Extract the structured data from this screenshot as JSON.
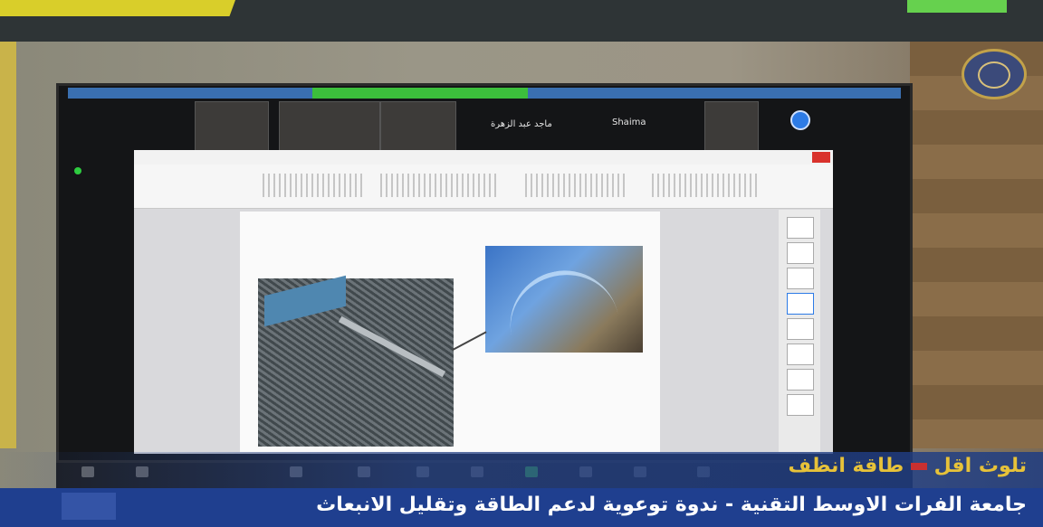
{
  "headline": {
    "part1": "تلوث اقل",
    "part2": "طاقة انظف"
  },
  "subline": "جامعة الفرات الاوسط التقنية - ندوة توعوية لدعم الطاقة وتقليل الانبعاث",
  "zoom": {
    "participant_names": [
      "ماجد عبد الزهرة",
      "Shaima"
    ]
  },
  "colors": {
    "accent_gold": "#e7c239",
    "band_blue": "#1f3f8f",
    "zoom_green": "#3cbf3c"
  },
  "icons": [
    "university-logo-icon",
    "recording-icon",
    "close-icon"
  ]
}
